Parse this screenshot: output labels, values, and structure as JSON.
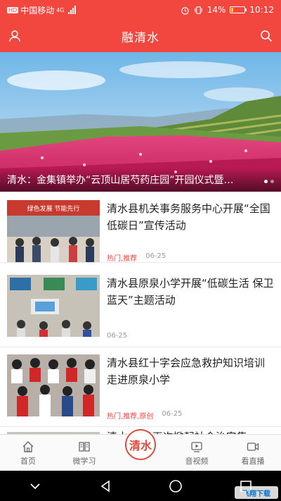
{
  "status_bar": {
    "carrier": "中国移动",
    "network": "4G",
    "tag": "HD",
    "battery": "14%",
    "time": "10:12",
    "battery_level": 0.14
  },
  "header": {
    "title": "融清水",
    "left_icon": "user-icon",
    "right_icon": "search-icon"
  },
  "banner": {
    "caption": "清水：金集镇举办“云顶山居芍药庄园”开园仪式暨…",
    "slide_count": 2,
    "active_slide": 1
  },
  "news": [
    {
      "title": "清水县机关事务服务中心开展“全国低碳日”宣传活动",
      "tags": "热门,推荐",
      "date": "06-25",
      "thumb_sign": "绿色发展  节能先行"
    },
    {
      "title": "清水县原泉小学开展“低碳生活 保卫蓝天”主题活动",
      "tags": "",
      "date": "06-25"
    },
    {
      "title": "清水县红十字会应急救护知识培训走进原泉小学",
      "tags": "热门,推荐,原创",
      "date": "06-25"
    },
    {
      "title": "清水… 县再次掀起社会治安集…"
    }
  ],
  "tabs": [
    {
      "label": "首页",
      "icon": "home-icon"
    },
    {
      "label": "微学习",
      "icon": "book-icon"
    },
    {
      "label": "清水",
      "icon": "center-logo"
    },
    {
      "label": "音视频",
      "icon": "video-icon"
    },
    {
      "label": "看直播",
      "icon": "camera-icon"
    }
  ],
  "watermark": "飞翔下载",
  "colors": {
    "brand_red": "#f2473f",
    "tag_red": "#f2473f",
    "meta_gray": "#999999"
  }
}
